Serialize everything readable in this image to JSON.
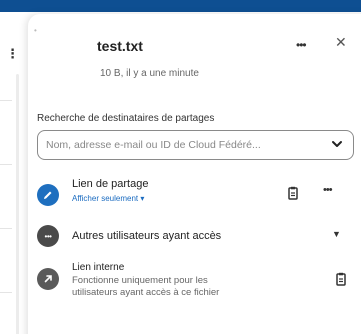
{
  "colors": {
    "topband": "#0e4f92",
    "share_link_avatar": "#1e6fbf",
    "others_avatar": "#4a4a4a",
    "internal_avatar": "#5a5a5a",
    "link_text": "#1a6bc0"
  },
  "background_app": {
    "icon": "vertical-dots-icon"
  },
  "header": {
    "title": "test.txt",
    "subtitle": "10 B, il y a une minute",
    "more_icon": "more-horizontal-icon",
    "close_icon": "close-icon"
  },
  "search": {
    "label": "Recherche de destinataires de partages",
    "placeholder": "Nom, adresse e-mail ou ID de Cloud Fédéré...",
    "dropdown_icon": "chevron-down-icon"
  },
  "shares": {
    "share_link": {
      "title": "Lien de partage",
      "permission": "Afficher seulement ▾",
      "icon": "pencil-icon",
      "copy_icon": "clipboard-icon",
      "more_icon": "more-horizontal-icon"
    },
    "other_users": {
      "title": "Autres utilisateurs ayant accès",
      "icon": "dots-icon",
      "expand_icon": "caret-down-icon"
    },
    "internal_link": {
      "title": "Lien interne",
      "description_line1": "Fonctionne uniquement pour les",
      "description_line2": "utilisateurs ayant accès à ce fichier",
      "icon": "external-link-icon",
      "copy_icon": "clipboard-icon"
    }
  }
}
